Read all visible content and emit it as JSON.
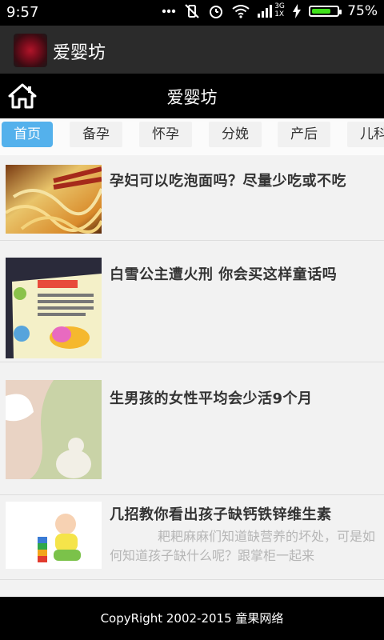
{
  "status_bar": {
    "time": "9:57",
    "signal_label": "3G",
    "signal_sub": "1X",
    "battery_percent_text": "75%",
    "battery_level": 0.75,
    "battery_color": "#3fe21a"
  },
  "app_bar": {
    "title": "爱婴坊"
  },
  "header": {
    "title": "爱婴坊"
  },
  "tabs": [
    {
      "label": "首页",
      "active": true
    },
    {
      "label": "备孕"
    },
    {
      "label": "怀孕"
    },
    {
      "label": "分娩"
    },
    {
      "label": "产后"
    },
    {
      "label": "儿科"
    }
  ],
  "articles": [
    {
      "title": "孕妇可以吃泡面吗？尽量少吃或不吃",
      "summary": ""
    },
    {
      "title": "白雪公主遭火刑 你会买这样童话吗",
      "summary": ""
    },
    {
      "title": "生男孩的女性平均会少活9个月",
      "summary": ""
    },
    {
      "title": "几招教你看出孩子缺钙铁锌维生素",
      "summary": "耙耙麻麻们知道缺营养的坏处，可是如何知道孩子缺什么呢？跟掌柜一起来"
    }
  ],
  "footer": {
    "copyright": "CopyRight 2002-2015 童果网络"
  },
  "colors": {
    "accent": "#54b1ec",
    "appbar": "#2b2b2b",
    "header": "#000000"
  }
}
